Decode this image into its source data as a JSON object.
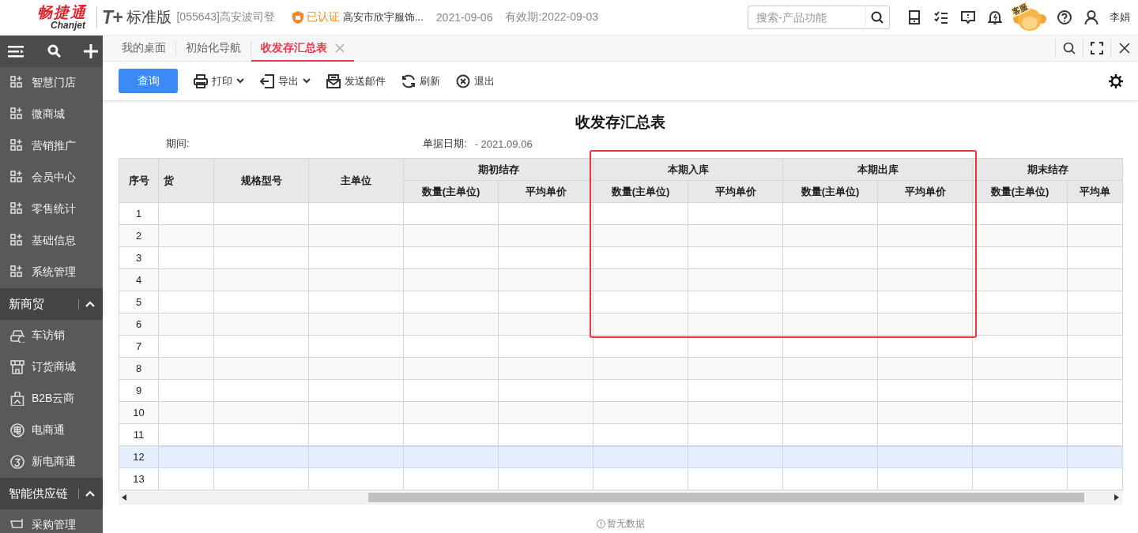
{
  "header": {
    "logo": "畅捷通",
    "logo_latin": "Chanjet",
    "product": "T+",
    "edition": "标准版",
    "account": "[055643]高安波司登",
    "certified": "已认证",
    "company": "高安市欣宇服饰...",
    "date": "2021-09-06",
    "validity": "有效期:2022-09-03",
    "search": {
      "placeholder": "搜索-产品功能"
    },
    "service_label": "客服",
    "user": "李娟"
  },
  "sidebar": {
    "items": [
      {
        "label": "智慧门店"
      },
      {
        "label": "微商城"
      },
      {
        "label": "营销推广"
      },
      {
        "label": "会员中心"
      },
      {
        "label": "零售统计"
      },
      {
        "label": "基础信息"
      },
      {
        "label": "系统管理"
      }
    ],
    "sections": [
      {
        "title": "新商贸",
        "expanded": true,
        "items": [
          {
            "label": "车访销"
          },
          {
            "label": "订货商城"
          },
          {
            "label": "B2B云商"
          },
          {
            "label": "电商通"
          },
          {
            "label": "新电商通"
          }
        ]
      },
      {
        "title": "智能供应链",
        "expanded": true,
        "items": [
          {
            "label": "采购管理"
          }
        ]
      }
    ]
  },
  "tabs": [
    {
      "label": "我的桌面",
      "selected": false,
      "closable": false
    },
    {
      "label": "初始化导航",
      "selected": false,
      "closable": false
    },
    {
      "label": "收发存汇总表",
      "selected": true,
      "closable": true
    }
  ],
  "toolbar": {
    "primary": "查询",
    "actions": [
      {
        "label": "打印",
        "dropdown": true
      },
      {
        "label": "导出",
        "dropdown": true
      },
      {
        "label": "发送邮件",
        "dropdown": false
      },
      {
        "label": "刷新",
        "dropdown": false
      },
      {
        "label": "退出",
        "dropdown": false
      }
    ]
  },
  "report": {
    "title": "收发存汇总表",
    "period_label": "期间:",
    "date_label": "单据日期:",
    "date_value": "- 2021.09.06",
    "table": {
      "columns": [
        {
          "label": "序号"
        },
        {
          "label": "货"
        },
        {
          "label": "规格型号"
        },
        {
          "label": "主单位"
        },
        {
          "label": "期初结存",
          "children": [
            "数量(主单位)",
            "平均单价"
          ]
        },
        {
          "label": "本期入库",
          "children": [
            "数量(主单位)",
            "平均单价"
          ]
        },
        {
          "label": "本期出库",
          "children": [
            "数量(主单位)",
            "平均单价"
          ]
        },
        {
          "label": "期末结存",
          "children": [
            "数量(主单位)",
            "平均单"
          ]
        }
      ],
      "rows": [
        {
          "index": "1",
          "selected": false
        },
        {
          "index": "2",
          "selected": false
        },
        {
          "index": "3",
          "selected": false
        },
        {
          "index": "4",
          "selected": false
        },
        {
          "index": "5",
          "selected": false
        },
        {
          "index": "6",
          "selected": false
        },
        {
          "index": "7",
          "selected": false
        },
        {
          "index": "8",
          "selected": false
        },
        {
          "index": "9",
          "selected": false
        },
        {
          "index": "10",
          "selected": false
        },
        {
          "index": "11",
          "selected": false
        },
        {
          "index": "12",
          "selected": true
        },
        {
          "index": "13",
          "selected": false
        }
      ]
    },
    "highlight": true,
    "empty_note": "暂无数据"
  }
}
